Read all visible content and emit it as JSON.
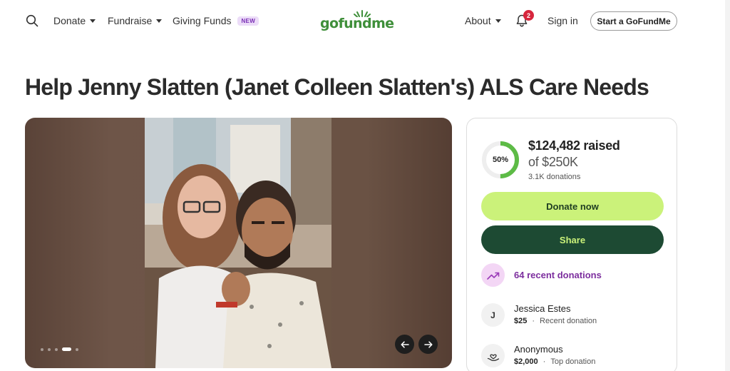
{
  "nav": {
    "donate": "Donate",
    "fundraise": "Fundraise",
    "giving_funds": "Giving Funds",
    "new_badge": "NEW",
    "logo": "gofundme",
    "about": "About",
    "notification_count": "2",
    "sign_in": "Sign in",
    "start": "Start a GoFundMe"
  },
  "title": "Help Jenny Slatten (Janet Colleen Slatten's) ALS Care Needs",
  "gallery": {
    "slide_count": 5,
    "active_slide": 4
  },
  "progress": {
    "percent_label": "50%",
    "percent": 50,
    "raised": "$124,482 raised",
    "goal": "of $250K",
    "donations": "3.1K donations"
  },
  "actions": {
    "donate": "Donate now",
    "share": "Share"
  },
  "recent": {
    "label": "64 recent donations"
  },
  "donors": [
    {
      "initial": "J",
      "name": "Jessica Estes",
      "amount": "$25",
      "tag": "Recent donation"
    },
    {
      "initial": "",
      "name": "Anonymous",
      "amount": "$2,000",
      "tag": "Top donation"
    }
  ],
  "colors": {
    "brand_green": "#3f8f3a",
    "donate_bg": "#cbf27a",
    "share_bg": "#1d4a33",
    "accent_purple": "#7c2e9e",
    "progress_green": "#5dbb46"
  },
  "icons": {
    "search": "search-icon",
    "bell": "bell-icon",
    "prev": "arrow-left-icon",
    "next": "arrow-right-icon",
    "trend": "trending-up-icon",
    "heart_hand": "heart-hand-icon"
  }
}
